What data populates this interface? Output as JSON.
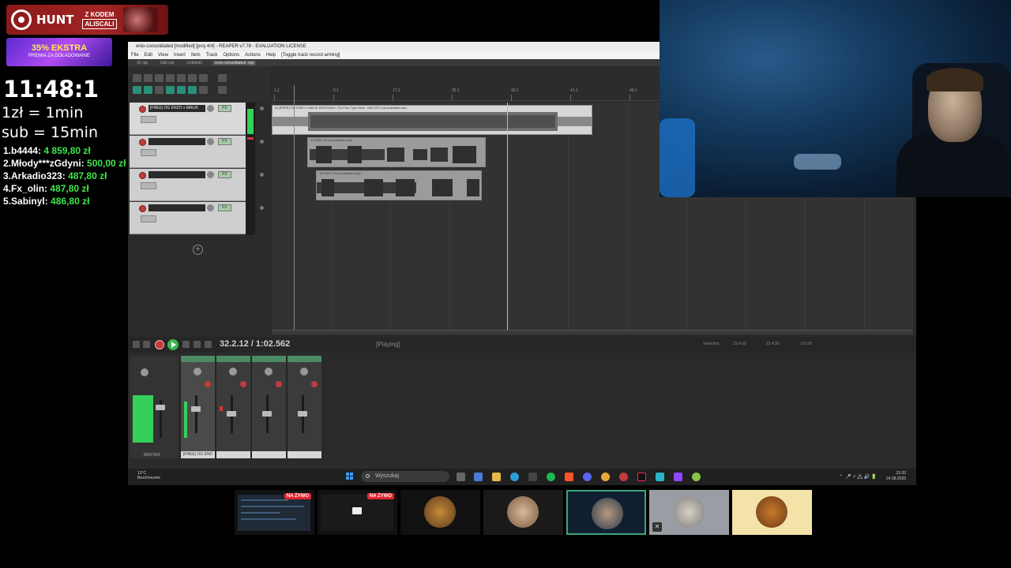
{
  "overlay": {
    "hunt": {
      "name": "HUNT",
      "code_prefix": "Z KODEM",
      "code": "ALISCALI"
    },
    "promo": {
      "main": "35% EKSTRA",
      "sub": "PREMIA ZA DOŁADOWANIE"
    },
    "timer": "11:48:1",
    "rate_min": "1zł = 1min",
    "rate_sub": "sub = 15min",
    "leaderboard": [
      {
        "rank": "1.",
        "name": "b4444:",
        "amount": "4 859,80 zł"
      },
      {
        "rank": "2.",
        "name": "Młody***zGdyni:",
        "amount": "500,00 zł"
      },
      {
        "rank": "3.",
        "name": "Arkadio323:",
        "amount": "487,80 zł"
      },
      {
        "rank": "4.",
        "name": "Fx_olin:",
        "amount": "487,80 zł"
      },
      {
        "rank": "5.",
        "name": "Sabinyl:",
        "amount": "486,80 zł"
      }
    ]
  },
  "reaper": {
    "title": "enio-consolidated [modified] [proj 4/4] - REAPER v7.78 - EVALUATION LICENSE",
    "menu": [
      "File",
      "Edit",
      "View",
      "Insert",
      "Item",
      "Track",
      "Options",
      "Actions",
      "Help",
      "[Toggle track record arming]"
    ],
    "tabs": [
      "32 rpp",
      "Edit rpp",
      "Untitled2",
      "enio-consolidated .rpp"
    ],
    "tracks": [
      {
        "name": "[FREE] OG ENZO x MALIK"
      },
      {
        "name": ""
      },
      {
        "name": ""
      },
      {
        "name": ""
      }
    ],
    "items": {
      "item1": "01-[FREE] OG ENZO x MALIK MONTANA x Tbr Free Type Beat - MACZETI-consolidated.wav",
      "item2": "15 ENIO 22-consolidated.wav",
      "item3": "16 ENIO 23-consolidated.wav"
    },
    "transport": {
      "time": "32.2.12 / 1:02.562",
      "state": "[Playing]",
      "selection_label": "Selection:",
      "sel_start": "23.4.00",
      "sel_end": "23.4.00",
      "sel_len": "0.0.00"
    },
    "mixer": {
      "master_label": "MASTER",
      "strip_names": [
        "[FREE] OG END",
        "",
        "",
        ""
      ]
    }
  },
  "taskbar": {
    "weather_temp": "13°C",
    "weather_desc": "Bezchmurnie",
    "search": "Wyszukaj",
    "time": "22:20",
    "date": "24.08.2026"
  },
  "thumbnails": {
    "live_label": "NA ŻYWO"
  }
}
